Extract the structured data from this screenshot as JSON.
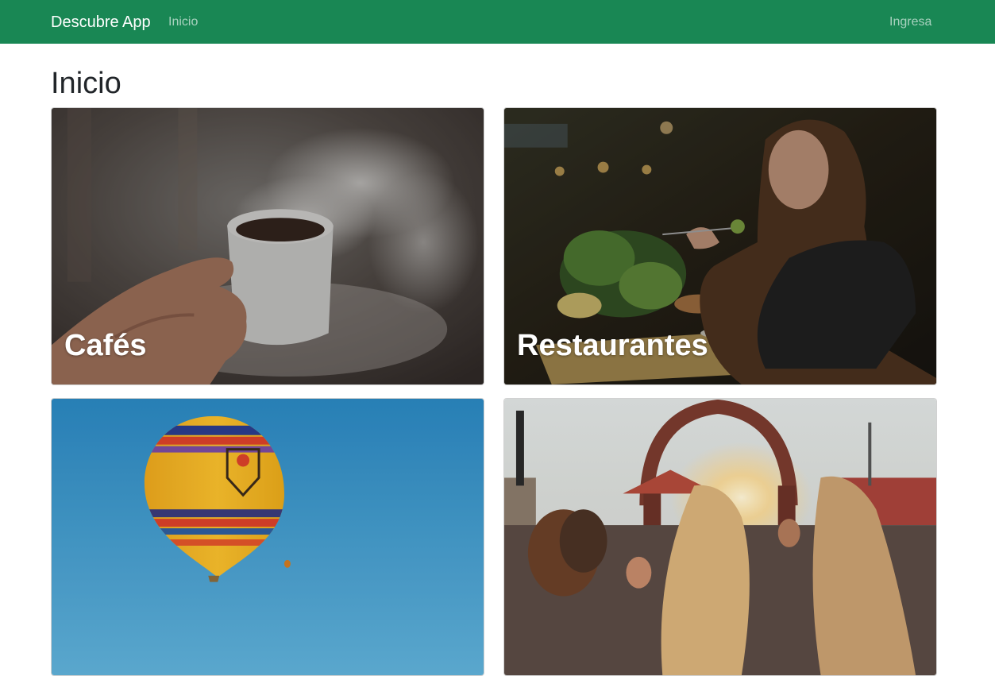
{
  "navbar": {
    "brand": "Descubre App",
    "links": [
      {
        "label": "Inicio"
      },
      {
        "label": "Ingresa"
      }
    ]
  },
  "page": {
    "title": "Inicio"
  },
  "cards": [
    {
      "title": "Cafés"
    },
    {
      "title": "Restaurantes"
    },
    {
      "title": ""
    },
    {
      "title": ""
    }
  ]
}
